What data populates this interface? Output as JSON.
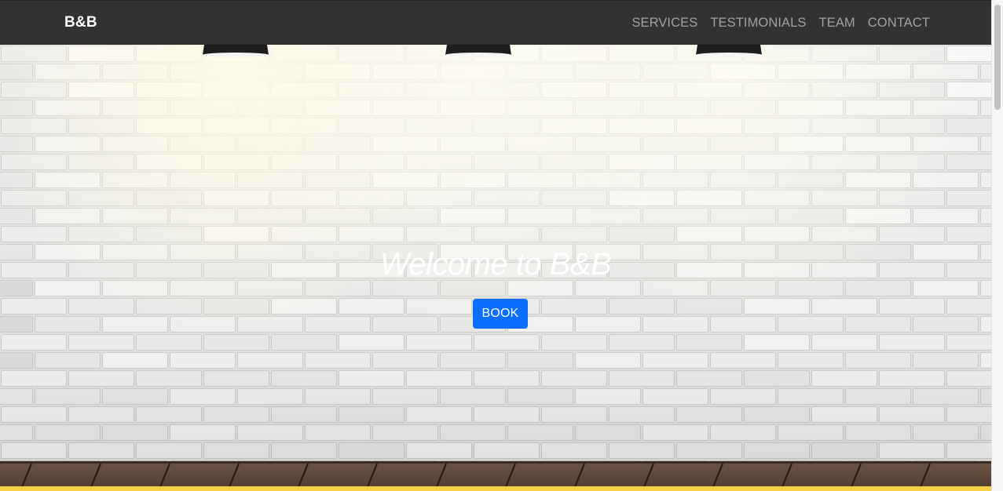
{
  "navbar": {
    "brand": "B&B",
    "links": [
      "SERVICES",
      "TESTIMONIALS",
      "TEAM",
      "CONTACT"
    ]
  },
  "hero": {
    "title": "Welcome to B&B",
    "book_label": "BOOK"
  },
  "colors": {
    "navbar_bg": "#323232",
    "brand_text": "#ffffff",
    "nav_link": "#a2a2a2",
    "button_bg": "#0d6efd",
    "strip": "#f7cf48"
  }
}
